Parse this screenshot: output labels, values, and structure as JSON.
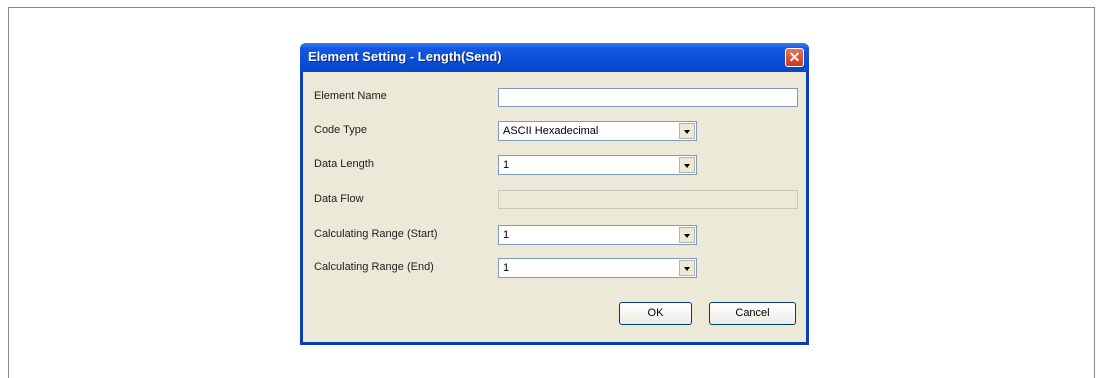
{
  "dialog": {
    "title": "Element Setting - Length(Send)",
    "close_icon": "close-icon"
  },
  "fields": {
    "element_name": {
      "label": "Element Name",
      "value": ""
    },
    "code_type": {
      "label": "Code Type",
      "value": "ASCII Hexadecimal"
    },
    "data_length": {
      "label": "Data Length",
      "value": "1"
    },
    "data_flow": {
      "label": "Data Flow",
      "value": ""
    },
    "calc_range_start": {
      "label": "Calculating Range (Start)",
      "value": "1"
    },
    "calc_range_end": {
      "label": "Calculating Range (End)",
      "value": "1"
    }
  },
  "buttons": {
    "ok": "OK",
    "cancel": "Cancel"
  },
  "colors": {
    "titlebar": "#0a4fd8",
    "dialog_bg": "#ece9d8",
    "close": "#c9391c"
  }
}
